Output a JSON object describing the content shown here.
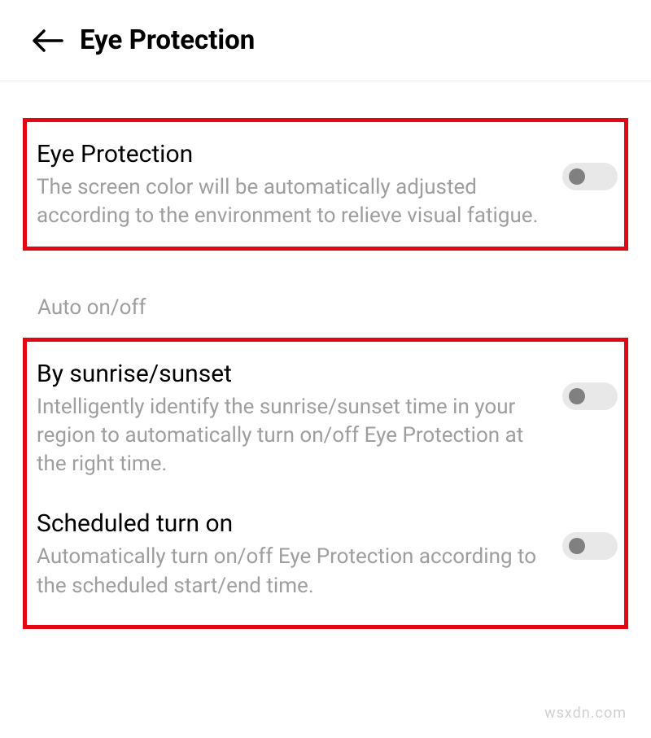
{
  "header": {
    "title": "Eye Protection"
  },
  "settings": {
    "eyeProtection": {
      "title": "Eye Protection",
      "description": "The screen color will be automatically adjusted according to the environment to relieve visual fatigue.",
      "enabled": false
    }
  },
  "sectionLabel": "Auto on/off",
  "autoSettings": {
    "bySunrise": {
      "title": "By sunrise/sunset",
      "description": "Intelligently identify the sunrise/sunset time in your region to automatically turn on/off Eye Protection at the right time.",
      "enabled": false
    },
    "scheduled": {
      "title": "Scheduled turn on",
      "description": "Automatically turn on/off Eye Protection according to the scheduled start/end time.",
      "enabled": false
    }
  },
  "watermark": "wsxdn.com"
}
